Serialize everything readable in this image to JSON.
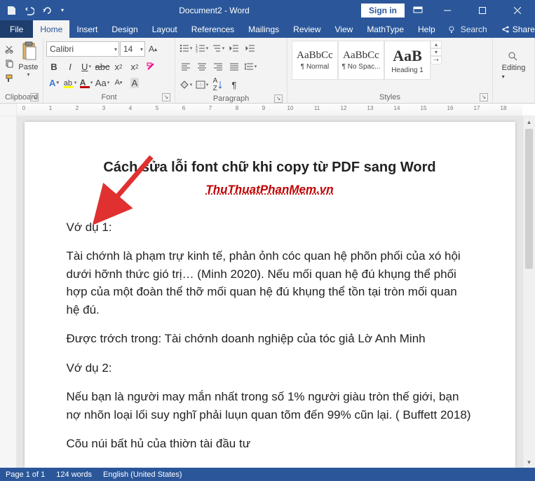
{
  "titlebar": {
    "document_title": "Document2 - Word",
    "signin": "Sign in"
  },
  "tabs": {
    "file": "File",
    "home": "Home",
    "insert": "Insert",
    "design": "Design",
    "layout": "Layout",
    "references": "References",
    "mailings": "Mailings",
    "review": "Review",
    "view": "View",
    "mathtype": "MathType",
    "help": "Help",
    "tell_me": "Search",
    "share": "Share"
  },
  "ribbon": {
    "clipboard": {
      "label": "Clipboard",
      "paste": "Paste"
    },
    "font": {
      "label": "Font",
      "name": "Calibri",
      "size": "14"
    },
    "paragraph": {
      "label": "Paragraph"
    },
    "styles": {
      "label": "Styles",
      "items": [
        {
          "preview": "AaBbCc",
          "label": "¶ Normal"
        },
        {
          "preview": "AaBbCc",
          "label": "¶ No Spac..."
        },
        {
          "preview": "AaB",
          "label": "Heading 1"
        }
      ]
    },
    "editing": {
      "label": "Editing"
    }
  },
  "document": {
    "title": "Cách sửa lỗi font chữ khi copy từ PDF sang Word",
    "site": "ThuThuatPhanMem.vn",
    "p1": "Vớ dụ 1:",
    "p2": "Tài chớnh là phạm trự kinh tế, phản ỏnh cóc quan hệ phõn phối của xó hội dưới hỡnh thức gió trị… (Minh 2020). Nếu mối quan hệ đú khụng thể phối hợp của một đoàn thể thỡ mối quan hệ đú khụng thể tồn tại tròn mối quan hệ đú.",
    "p3": "Được trớch trong: Tài chớnh doanh nghiệp của tóc giả Lờ Anh Minh",
    "p4": "Vớ dụ 2:",
    "p5": "Nếu bạn là người may mắn nhất trong số 1% người giàu tròn thế giới, bạn nợ nhõn loại lối suy nghĩ phải luụn quan tõm đến 99% cũn lại. ( Buffett 2018)",
    "p6": "Cõu núi bất hủ của thiờn tài đầu tư"
  },
  "statusbar": {
    "page": "Page 1 of 1",
    "words": "124 words",
    "language": "English (United States)"
  }
}
